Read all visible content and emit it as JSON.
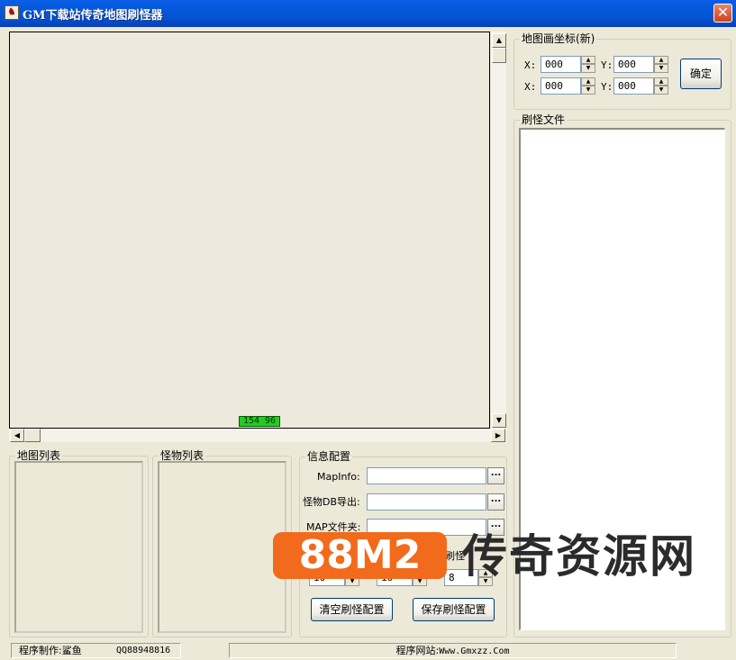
{
  "window": {
    "title": "GM下载站传奇地图刷怪器",
    "icon_name": "app-icon",
    "close_glyph": "✕"
  },
  "map_view": {
    "coord_readout": "154 96"
  },
  "map_coords": {
    "group_label": "地图画坐标(新)",
    "row1": {
      "x_label": "X:",
      "x_value": "000",
      "y_label": "Y:",
      "y_value": "000"
    },
    "row2": {
      "x_label": "X:",
      "x_value": "000",
      "y_label": "Y:",
      "y_value": "000"
    },
    "confirm_label": "确定"
  },
  "spawn_files": {
    "group_label": "刷怪文件"
  },
  "map_list": {
    "group_label": "地图列表"
  },
  "monster_list": {
    "group_label": "怪物列表"
  },
  "info_config": {
    "group_label": "信息配置",
    "mapinfo_label": "MapInfo:",
    "mapinfo_value": "",
    "monster_db_label": "怪物DB导出:",
    "monster_db_value": "",
    "map_folder_label": "MAP文件夹:",
    "map_folder_value": "",
    "spawn_label_partial": "刷怪",
    "spin1_value": "10",
    "spin2_value": "10",
    "spin3_value": "8",
    "clear_button": "清空刷怪配置",
    "save_button": "保存刷怪配置",
    "browse_glyph": "..."
  },
  "statusbar": {
    "author": "程序制作:鲨鱼",
    "qq": "QQ88948816",
    "website_label": "程序网站:",
    "website": "Www.Gmxzz.Com"
  },
  "watermark": {
    "brand": "88M2",
    "text": "传奇资源网",
    "brand_color": "#f26a1b"
  }
}
